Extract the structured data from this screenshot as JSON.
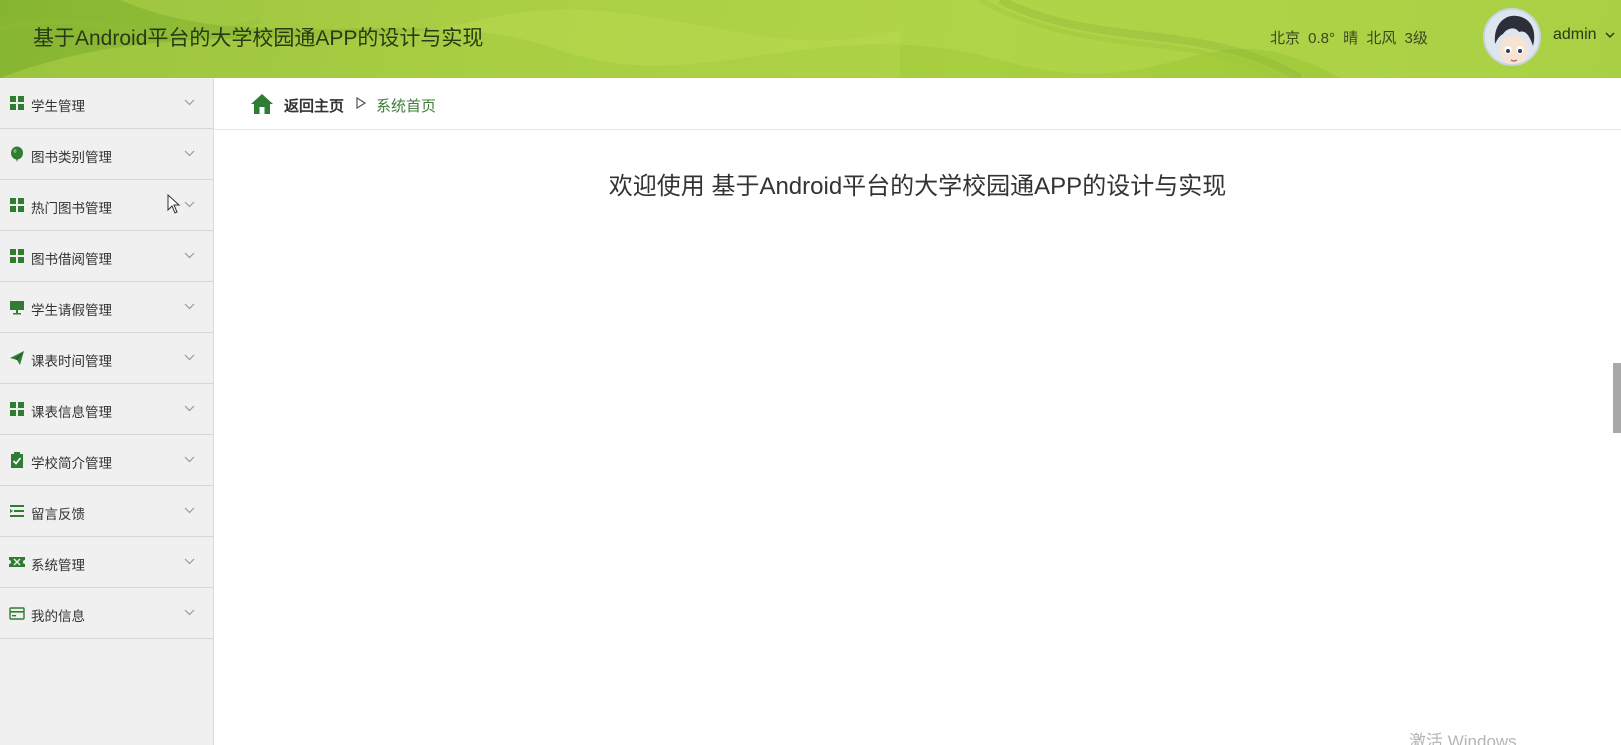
{
  "header": {
    "title": "基于Android平台的大学校园通APP的设计与实现",
    "weather": "北京  0.8°  晴  北风  3级",
    "user_name": "admin",
    "avatar_icon": "anime-avatar-icon",
    "caret_icon": "chevron-down-icon",
    "brand_color": "#9dc63a"
  },
  "sidebar": {
    "items": [
      {
        "label": "学生管理",
        "icon": "grid-icon"
      },
      {
        "label": "图书类别管理",
        "icon": "balloon-icon"
      },
      {
        "label": "热门图书管理",
        "icon": "grid-icon"
      },
      {
        "label": "图书借阅管理",
        "icon": "grid-icon"
      },
      {
        "label": "学生请假管理",
        "icon": "monitor-icon"
      },
      {
        "label": "课表时间管理",
        "icon": "paper-plane-icon"
      },
      {
        "label": "课表信息管理",
        "icon": "grid-icon"
      },
      {
        "label": "学校简介管理",
        "icon": "clipboard-check-icon"
      },
      {
        "label": "留言反馈",
        "icon": "list-indent-icon"
      },
      {
        "label": "系统管理",
        "icon": "ticket-icon"
      },
      {
        "label": "我的信息",
        "icon": "card-icon"
      }
    ],
    "icon_color": "#2e7d32"
  },
  "breadcrumb": {
    "home_label": "返回主页",
    "separator": "▷",
    "current": "系统首页"
  },
  "main": {
    "welcome": "欢迎使用 基于Android平台的大学校园通APP的设计与实现"
  },
  "watermark": "激活 Windows"
}
